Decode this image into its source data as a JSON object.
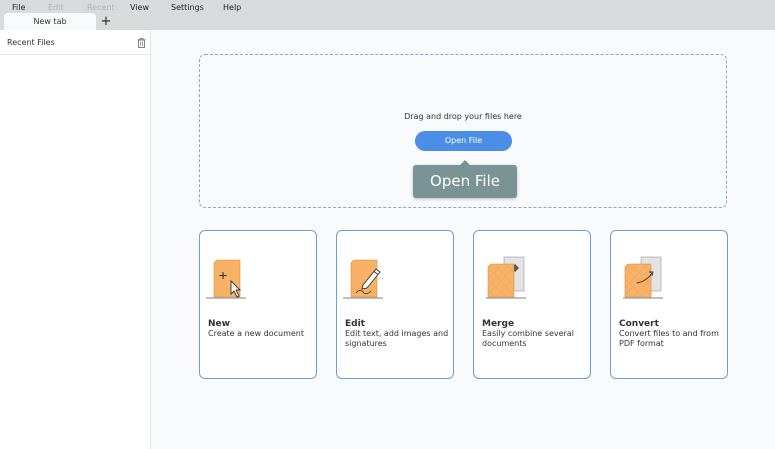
{
  "menu": {
    "file": "File",
    "edit": "Edit",
    "recent": "Recent",
    "view": "View",
    "settings": "Settings",
    "help": "Help"
  },
  "tab": {
    "label": "New tab",
    "add_symbol": "+"
  },
  "sidebar": {
    "title": "Recent Files",
    "trash_icon": "trash-icon"
  },
  "dropzone": {
    "instruction": "Drag and drop your files here",
    "open_button": "Open File",
    "tooltip": "Open File"
  },
  "cards": [
    {
      "title": "New",
      "description": "Create a new document",
      "icon": "new-document-icon"
    },
    {
      "title": "Edit",
      "description": "Edit text, add images and signatures",
      "icon": "edit-document-icon"
    },
    {
      "title": "Merge",
      "description": "Easily combine several documents",
      "icon": "merge-documents-icon"
    },
    {
      "title": "Convert",
      "description": "Convert files to and from PDF format",
      "icon": "convert-document-icon"
    }
  ],
  "colors": {
    "accent": "#4a8ee6",
    "card_border": "#6b9fd8",
    "doc_orange": "#f7b267",
    "tooltip_bg": "#7a9496"
  }
}
